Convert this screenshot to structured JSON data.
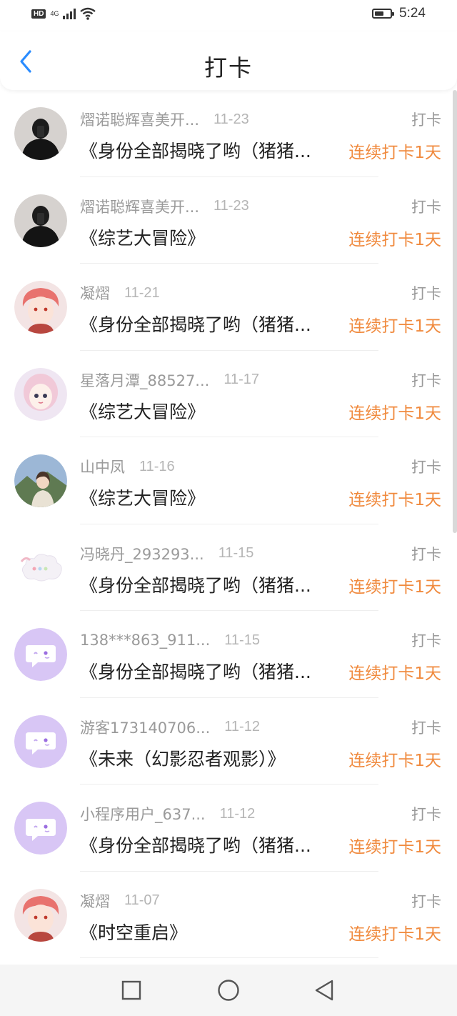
{
  "status_bar": {
    "hd": "HD",
    "network": "4G",
    "time": "5:24",
    "battery_level": 0.6,
    "icons": [
      "signal-icon",
      "wifi-icon",
      "battery-icon"
    ]
  },
  "header": {
    "title": "打卡",
    "back_icon": "chevron-left-icon",
    "accent": "#2a8cff"
  },
  "items": [
    {
      "name": "熠诺聪辉喜美开...",
      "date": "11-23",
      "type": "打卡",
      "title": "《身份全部揭晓了哟（猪猪...",
      "streak": "连续打卡1天",
      "avatar": "dark"
    },
    {
      "name": "熠诺聪辉喜美开...",
      "date": "11-23",
      "type": "打卡",
      "title": "《综艺大冒险》",
      "streak": "连续打卡1天",
      "avatar": "dark"
    },
    {
      "name": "凝熠",
      "date": "11-21",
      "type": "打卡",
      "title": "《身份全部揭晓了哟（猪猪...",
      "streak": "连续打卡1天",
      "avatar": "pink"
    },
    {
      "name": "星落月潭_88527...",
      "date": "11-17",
      "type": "打卡",
      "title": "《综艺大冒险》",
      "streak": "连续打卡1天",
      "avatar": "doll"
    },
    {
      "name": "山中凤",
      "date": "11-16",
      "type": "打卡",
      "title": "《综艺大冒险》",
      "streak": "连续打卡1天",
      "avatar": "photo"
    },
    {
      "name": "冯晓丹_293293...",
      "date": "11-15",
      "type": "打卡",
      "title": "《身份全部揭晓了哟（猪猪...",
      "streak": "连续打卡1天",
      "avatar": "cloud"
    },
    {
      "name": "138***863_911...",
      "date": "11-15",
      "type": "打卡",
      "title": "《身份全部揭晓了哟（猪猪...",
      "streak": "连续打卡1天",
      "avatar": "default"
    },
    {
      "name": "游客173140706...",
      "date": "11-12",
      "type": "打卡",
      "title": "《未来（幻影忍者观影）》",
      "streak": "连续打卡1天",
      "avatar": "default"
    },
    {
      "name": "小程序用户_637...",
      "date": "11-12",
      "type": "打卡",
      "title": "《身份全部揭晓了哟（猪猪...",
      "streak": "连续打卡1天",
      "avatar": "default"
    },
    {
      "name": "凝熠",
      "date": "11-07",
      "type": "打卡",
      "title": "《时空重启》",
      "streak": "连续打卡1天",
      "avatar": "pink"
    }
  ],
  "colors": {
    "streak": "#f08a3e",
    "muted_text": "#9a9a9a",
    "default_avatar": "#d8c6f5"
  },
  "nav_bar": {
    "icons": [
      "recent-apps-icon",
      "home-icon",
      "back-triangle-icon"
    ]
  }
}
